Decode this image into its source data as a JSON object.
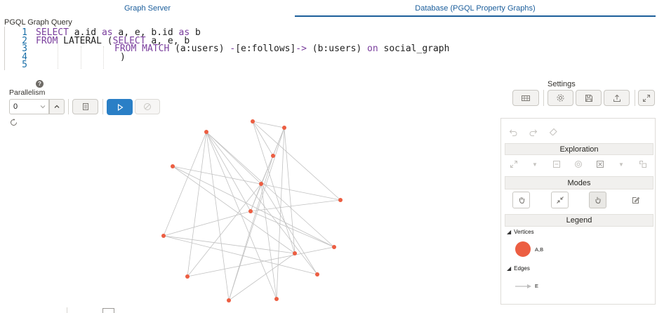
{
  "tabs": [
    {
      "label": "Graph Server",
      "active": false
    },
    {
      "label": "Database (PGQL Property Graphs)",
      "active": true
    }
  ],
  "editor": {
    "title": "PGQL Graph Query",
    "lines": [
      {
        "num": "1"
      },
      {
        "num": "2"
      },
      {
        "num": "3"
      },
      {
        "num": "4"
      },
      {
        "num": "5"
      }
    ],
    "tokens": {
      "select1": "SELECT",
      "l1a": " a.id ",
      "as1": "as",
      "l1b": " a, e, b.id ",
      "as2": "as",
      "l1c": " b",
      "from1": "FROM",
      "lateral": " LATERAL (",
      "select2": "SELECT",
      "l2b": " a, e, b",
      "from2": "FROM",
      "match": "MATCH",
      "l3a": " (a:users) ",
      "arr1": "-",
      "l3b": "[e:follows]",
      "arr2": "->",
      "l3c": " (b:users) ",
      "on": "on",
      "l3d": " social_graph",
      "l4": ")"
    }
  },
  "toolbar": {
    "help_glyph": "?",
    "parallelism_label": "Parallelism",
    "parallelism_value": "0",
    "settings_label": "Settings"
  },
  "side_panel": {
    "exploration_title": "Exploration",
    "modes_title": "Modes",
    "legend_title": "Legend",
    "vertices_heading": "Vertices",
    "vertex_label": "A,B",
    "vertex_color": "#ec5e42",
    "edges_heading": "Edges",
    "edge_label": "E"
  },
  "graph": {
    "node_color": "#ec5e42",
    "edge_color": "#c2c2c2",
    "node_count": 16,
    "edge_count": 33
  }
}
